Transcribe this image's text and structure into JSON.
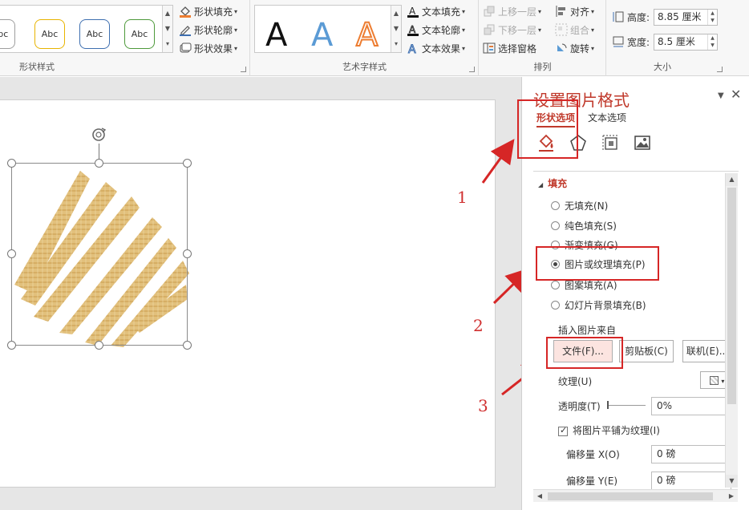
{
  "ribbon": {
    "shape_styles": {
      "label": "形状样式",
      "samples": [
        "Abc",
        "Abc",
        "Abc",
        "Abc"
      ],
      "sample_colors": [
        "#9e9e9e",
        "#e8b400",
        "#3e6fb0",
        "#4e9a3b"
      ],
      "fill": "形状填充",
      "outline": "形状轮廓",
      "effects": "形状效果"
    },
    "wordart": {
      "label": "艺术字样式",
      "letters": [
        "A",
        "A",
        "A"
      ],
      "letter_colors": [
        "#111111",
        "#5b9bd5",
        "#ed7d31"
      ],
      "text_fill": "文本填充",
      "text_outline": "文本轮廓",
      "text_effects": "文本效果"
    },
    "arrange": {
      "label": "排列",
      "bring_forward": "上移一层",
      "send_backward": "下移一层",
      "selection_pane": "选择窗格",
      "align": "对齐",
      "group": "组合",
      "rotate": "旋转"
    },
    "size": {
      "label": "大小",
      "height_label": "高度:",
      "height_value": "8.85 厘米",
      "width_label": "宽度:",
      "width_value": "8.5 厘米"
    }
  },
  "annotations": [
    "1",
    "2",
    "3"
  ],
  "pane": {
    "title": "设置图片格式",
    "tabs": [
      "形状选项",
      "文本选项"
    ],
    "icons": [
      "fill-line-icon",
      "effects-pentagon-icon",
      "size-properties-icon",
      "picture-icon"
    ],
    "section": "填充",
    "fill_options": [
      {
        "label": "无填充(N)",
        "selected": false
      },
      {
        "label": "纯色填充(S)",
        "selected": false
      },
      {
        "label": "渐变填充(G)",
        "selected": false
      },
      {
        "label": "图片或纹理填充(P)",
        "selected": true
      },
      {
        "label": "图案填充(A)",
        "selected": false
      },
      {
        "label": "幻灯片背景填充(B)",
        "selected": false
      }
    ],
    "insert_from_label": "插入图片来自",
    "file_button": "文件(F)...",
    "clipboard_button": "剪贴板(C)",
    "online_button": "联机(E)...",
    "texture_label": "纹理(U)",
    "transparency_label": "透明度(T)",
    "transparency_value": "0%",
    "tile_label": "将图片平铺为纹理(I)",
    "tile_checked": true,
    "offset_x_label": "偏移量 X(O)",
    "offset_x_value": "0 磅",
    "offset_y_label": "偏移量 Y(E)",
    "offset_y_value": "0 磅"
  },
  "colors": {
    "accent": "#c0392b",
    "annotation": "#d62626",
    "texture": "#d9b46a"
  }
}
